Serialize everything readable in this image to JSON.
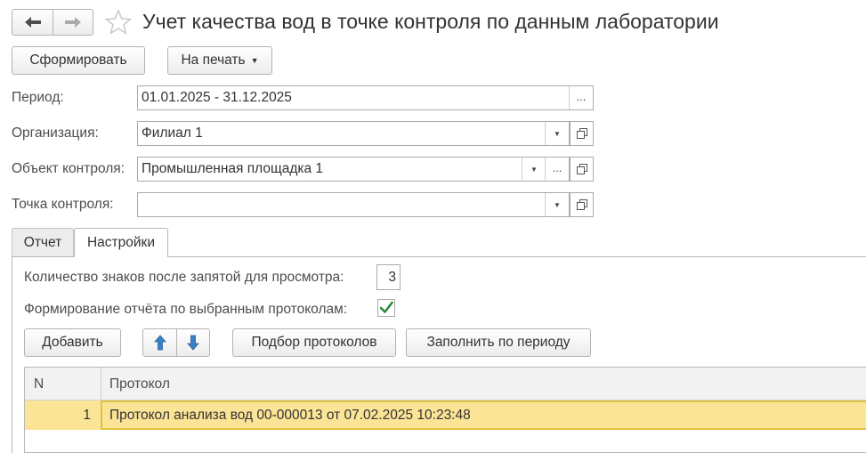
{
  "window": {
    "title": "Учет качества вод в точке контроля по данным лаборатории"
  },
  "toolbar": {
    "generate_label": "Сформировать",
    "print_label": "На печать"
  },
  "form": {
    "period": {
      "label": "Период:",
      "value": "01.01.2025 - 31.12.2025"
    },
    "organization": {
      "label": "Организация:",
      "value": "Филиал 1"
    },
    "control_object": {
      "label": "Объект контроля:",
      "value": "Промышленная площадка 1"
    },
    "control_point": {
      "label": "Точка контроля:",
      "value": ""
    }
  },
  "tabs": [
    {
      "label": "Отчет",
      "active": false
    },
    {
      "label": "Настройки",
      "active": true
    }
  ],
  "settings": {
    "decimals_label": "Количество знаков после запятой для просмотра:",
    "decimals_value": "3",
    "by_protocols_label": "Формирование отчёта по выбранным протоколам:",
    "by_protocols_checked": true,
    "add_label": "Добавить",
    "pick_protocols_label": "Подбор протоколов",
    "fill_period_label": "Заполнить по периоду"
  },
  "table": {
    "columns": [
      "N",
      "Протокол"
    ],
    "rows": [
      {
        "n": "1",
        "protocol": "Протокол анализа вод 00-000013 от 07.02.2025 10:23:48"
      }
    ]
  },
  "icons": {
    "back": "arrow-left-icon",
    "forward": "arrow-right-icon",
    "favorite": "star-icon",
    "move_up": "arrow-up-icon",
    "move_down": "arrow-down-icon"
  },
  "colors": {
    "selected_row": "#fbe495",
    "selected_border": "#e0c23d",
    "arrow_blue": "#3b7fc4",
    "checkbox_green": "#2e8b3a"
  }
}
